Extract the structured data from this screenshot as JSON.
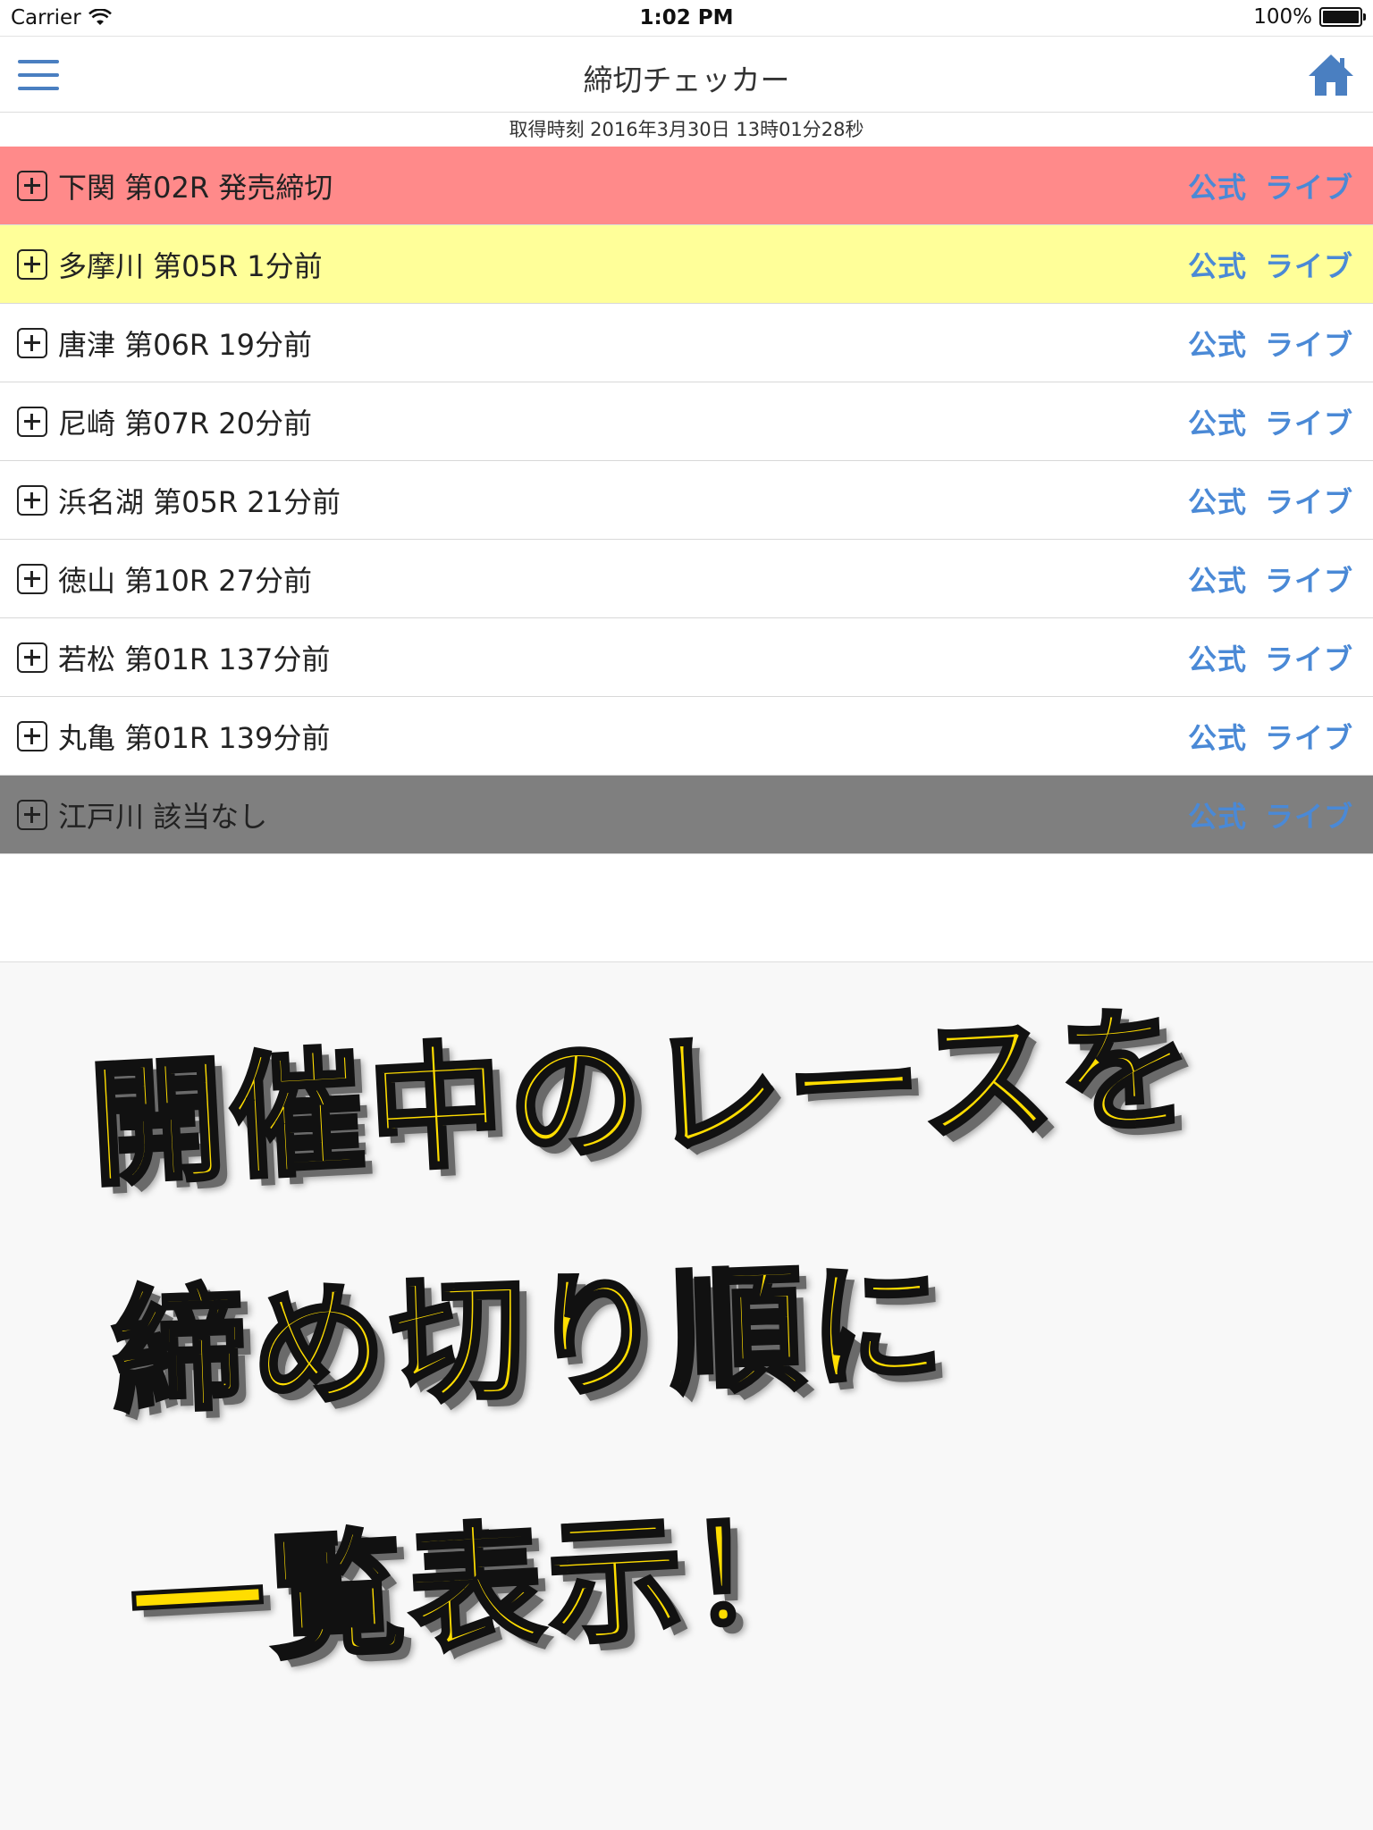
{
  "status_bar": {
    "carrier": "Carrier",
    "time": "1:02 PM",
    "battery": "100%"
  },
  "nav": {
    "title": "締切チェッカー",
    "menu_icon": "hamburger-menu-icon",
    "home_icon": "home-icon",
    "accent_color": "#4a7fc1"
  },
  "timestamp": "取得時刻 2016年3月30日 13時01分28秒",
  "races": [
    {
      "label": "下関 第02R 発売締切",
      "official": "公式",
      "live": "ライブ",
      "status": "closed",
      "color": "#ff8a8a"
    },
    {
      "label": "多摩川 第05R 1分前",
      "official": "公式",
      "live": "ライブ",
      "status": "imminent",
      "color": "#ffff99"
    },
    {
      "label": "唐津 第06R 19分前",
      "official": "公式",
      "live": "ライブ",
      "status": "open",
      "color": "#ffffff"
    },
    {
      "label": "尼崎 第07R 20分前",
      "official": "公式",
      "live": "ライブ",
      "status": "open",
      "color": "#ffffff"
    },
    {
      "label": "浜名湖 第05R 21分前",
      "official": "公式",
      "live": "ライブ",
      "status": "open",
      "color": "#ffffff"
    },
    {
      "label": "徳山 第10R 27分前",
      "official": "公式",
      "live": "ライブ",
      "status": "open",
      "color": "#ffffff"
    },
    {
      "label": "若松 第01R 137分前",
      "official": "公式",
      "live": "ライブ",
      "status": "open",
      "color": "#ffffff"
    },
    {
      "label": "丸亀 第01R 139分前",
      "official": "公式",
      "live": "ライブ",
      "status": "open",
      "color": "#ffffff"
    },
    {
      "label": "江戸川 該当なし",
      "official": "公式",
      "live": "ライブ",
      "status": "none",
      "color": "#7f7f7f"
    }
  ],
  "promo": {
    "line1": "開催中のレースを",
    "line2": "締め切り順に",
    "line3": "一覧表示！",
    "text_color": "#ffdd00"
  }
}
